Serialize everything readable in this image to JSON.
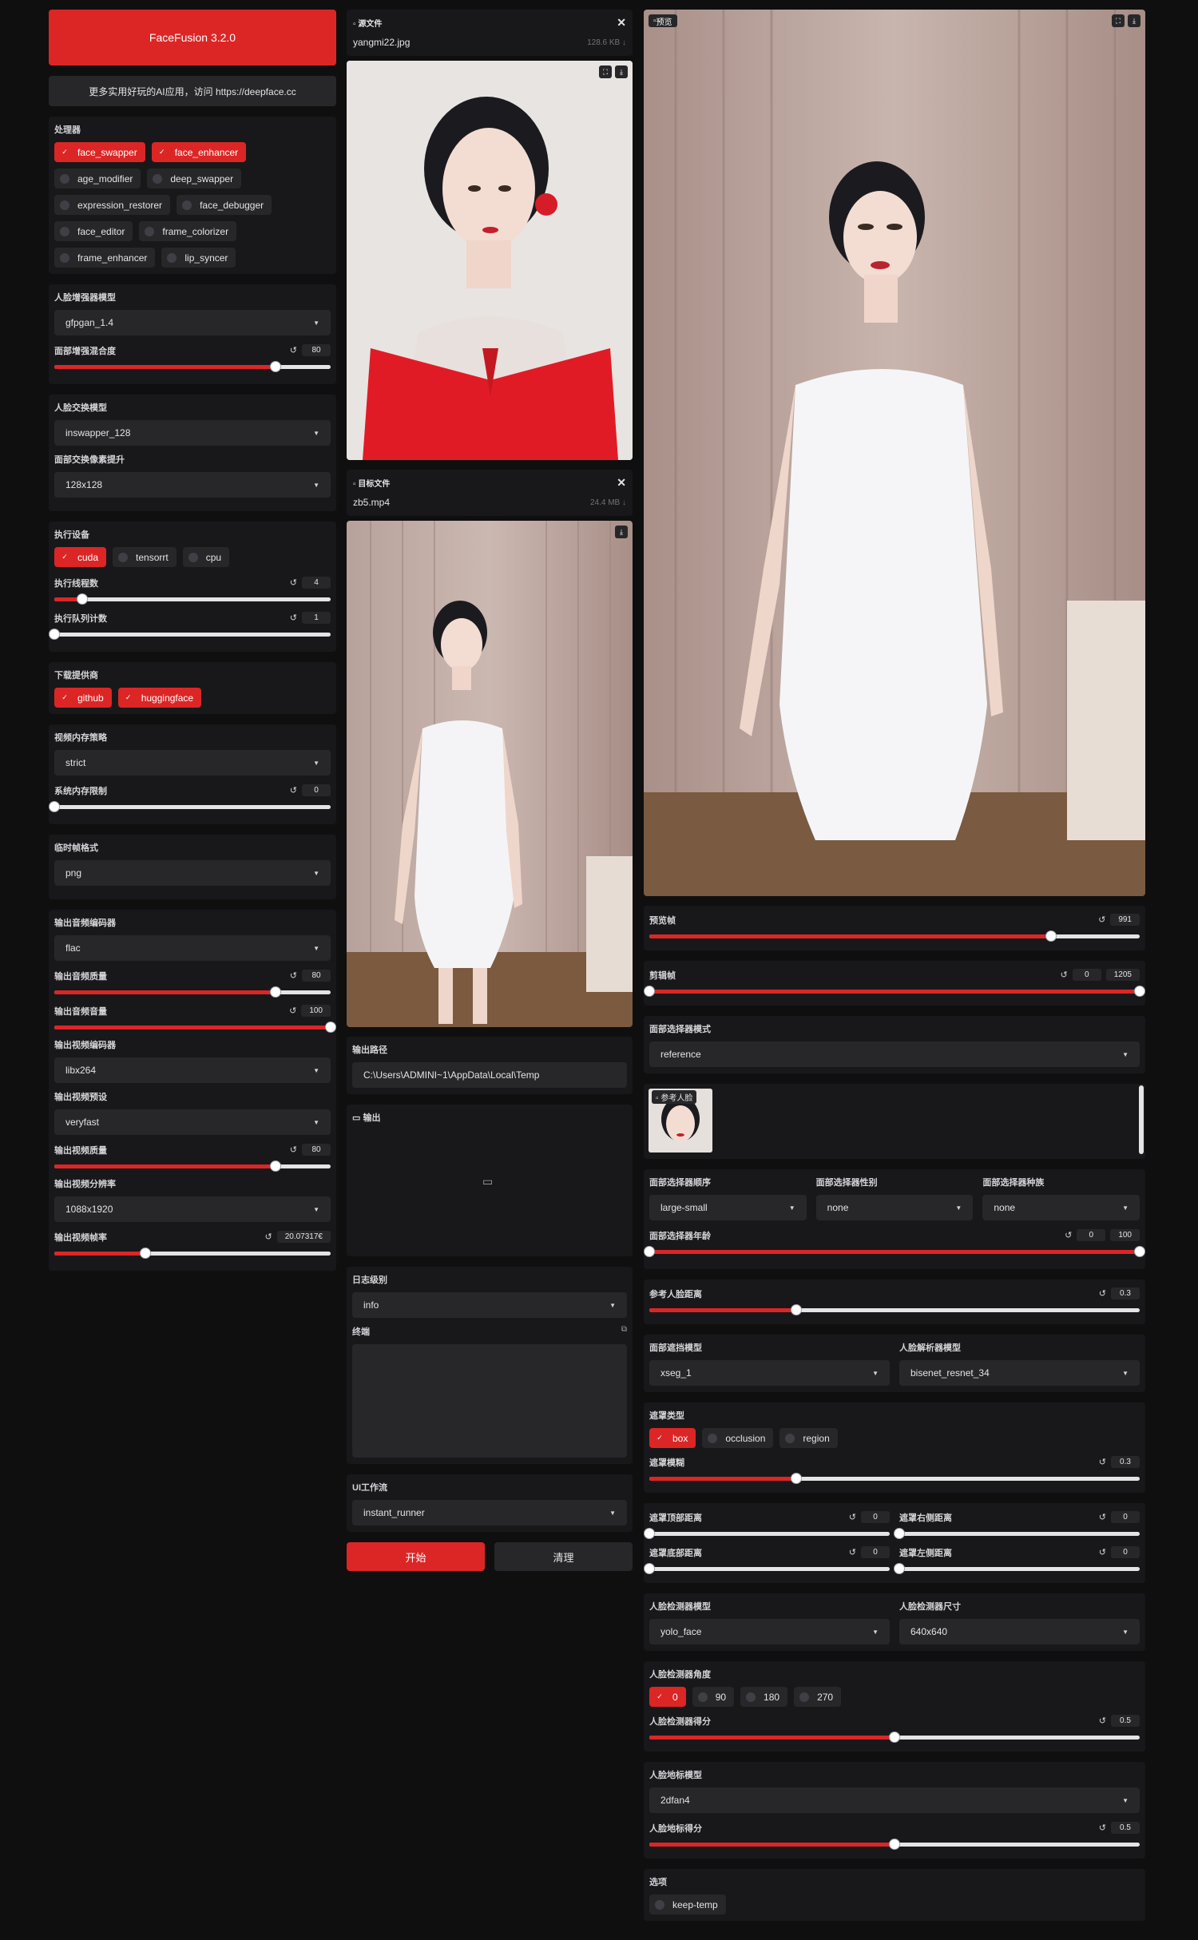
{
  "app": {
    "title": "FaceFusion 3.2.0",
    "banner": "更多实用好玩的AI应用，访问 https://deepface.cc"
  },
  "processors": {
    "label": "处理器",
    "items": [
      {
        "name": "face_swapper",
        "on": true
      },
      {
        "name": "face_enhancer",
        "on": true
      },
      {
        "name": "age_modifier",
        "on": false
      },
      {
        "name": "deep_swapper",
        "on": false
      },
      {
        "name": "expression_restorer",
        "on": false
      },
      {
        "name": "face_debugger",
        "on": false
      },
      {
        "name": "face_editor",
        "on": false
      },
      {
        "name": "frame_colorizer",
        "on": false
      },
      {
        "name": "frame_enhancer",
        "on": false
      },
      {
        "name": "lip_syncer",
        "on": false
      }
    ]
  },
  "enhancer": {
    "model_label": "人脸增强器模型",
    "model": "gfpgan_1.4",
    "blend_label": "面部增强混合度",
    "blend": "80",
    "blend_frac": 0.8
  },
  "swapper": {
    "model_label": "人脸交换模型",
    "model": "inswapper_128",
    "boost_label": "面部交换像素提升",
    "boost": "128x128"
  },
  "execution": {
    "label": "执行设备",
    "providers": [
      {
        "name": "cuda",
        "on": true
      },
      {
        "name": "tensorrt",
        "on": false
      },
      {
        "name": "cpu",
        "on": false
      }
    ],
    "threads_label": "执行线程数",
    "threads": "4",
    "threads_frac": 0.1,
    "queue_label": "执行队列计数",
    "queue": "1",
    "queue_frac": 0.0
  },
  "download": {
    "label": "下载提供商",
    "providers": [
      {
        "name": "github",
        "on": true
      },
      {
        "name": "huggingface",
        "on": true
      }
    ]
  },
  "memory": {
    "strategy_label": "视频内存策略",
    "strategy": "strict",
    "limit_label": "系统内存限制",
    "limit": "0",
    "limit_frac": 0.0
  },
  "temp": {
    "format_label": "临时帧格式",
    "format": "png"
  },
  "output_audio": {
    "encoder_label": "输出音频编码器",
    "encoder": "flac",
    "quality_label": "输出音频质量",
    "quality": "80",
    "quality_frac": 0.8,
    "volume_label": "输出音频音量",
    "volume": "100",
    "volume_frac": 1.0
  },
  "output_video": {
    "encoder_label": "输出视频编码器",
    "encoder": "libx264",
    "preset_label": "输出视频预设",
    "preset": "veryfast",
    "quality_label": "输出视频质量",
    "quality": "80",
    "quality_frac": 0.8,
    "resolution_label": "输出视频分辨率",
    "resolution": "1088x1920",
    "fps_label": "输出视频帧率",
    "fps": "20.07317€",
    "fps_frac": 0.33
  },
  "source": {
    "label": "源文件",
    "file": "yangmi22.jpg",
    "size": "128.6 KB ↓"
  },
  "target": {
    "label": "目标文件",
    "file": "zb5.mp4",
    "size": "24.4 MB ↓"
  },
  "output_path": {
    "label": "输出路径",
    "value": "C:\\Users\\ADMINI~1\\AppData\\Local\\Temp"
  },
  "output": {
    "label": "输出"
  },
  "log": {
    "label": "日志级别",
    "value": "info"
  },
  "terminal": {
    "label": "终端"
  },
  "workflow": {
    "label": "UI工作流",
    "value": "instant_runner"
  },
  "actions": {
    "start": "开始",
    "clear": "清理"
  },
  "preview": {
    "label": "预览",
    "frame_label": "预览帧",
    "frame": "991",
    "frame_frac": 0.82,
    "trim_label": "剪辑帧",
    "trim_start": "0",
    "trim_end": "1205"
  },
  "selector": {
    "mode_label": "面部选择器模式",
    "mode": "reference",
    "ref_label": "参考人脸",
    "order_label": "面部选择器顺序",
    "order": "large-small",
    "gender_label": "面部选择器性别",
    "gender": "none",
    "race_label": "面部选择器种族",
    "race": "none",
    "age_label": "面部选择器年龄",
    "age_start": "0",
    "age_end": "100",
    "distance_label": "参考人脸距离",
    "distance": "0.3",
    "distance_frac": 0.3
  },
  "mask": {
    "occluder_label": "面部遮挡模型",
    "occluder": "xseg_1",
    "parser_label": "人脸解析器模型",
    "parser": "bisenet_resnet_34",
    "types_label": "遮罩类型",
    "types": [
      {
        "name": "box",
        "on": true
      },
      {
        "name": "occlusion",
        "on": false
      },
      {
        "name": "region",
        "on": false
      }
    ],
    "blur_label": "遮罩模糊",
    "blur": "0.3",
    "blur_frac": 0.3,
    "top_label": "遮罩顶部距离",
    "top": "0",
    "right_label": "遮罩右侧距离",
    "right": "0",
    "bottom_label": "遮罩底部距离",
    "bottom": "0",
    "left_label": "遮罩左侧距离",
    "left": "0"
  },
  "detector": {
    "model_label": "人脸检测器模型",
    "model": "yolo_face",
    "size_label": "人脸检测器尺寸",
    "size": "640x640",
    "angles_label": "人脸检测器角度",
    "angles": [
      {
        "name": "0",
        "on": true
      },
      {
        "name": "90",
        "on": false
      },
      {
        "name": "180",
        "on": false
      },
      {
        "name": "270",
        "on": false
      }
    ],
    "score_label": "人脸检测器得分",
    "score": "0.5",
    "score_frac": 0.5
  },
  "landmarker": {
    "model_label": "人脸地标模型",
    "model": "2dfan4",
    "score_label": "人脸地标得分",
    "score": "0.5",
    "score_frac": 0.5
  },
  "options": {
    "label": "选项",
    "items": [
      {
        "name": "keep-temp",
        "on": false
      }
    ]
  },
  "colors": {
    "accent": "#dc2626",
    "panel": "#18181b",
    "field": "#27272a",
    "bg": "#0f0f10"
  }
}
